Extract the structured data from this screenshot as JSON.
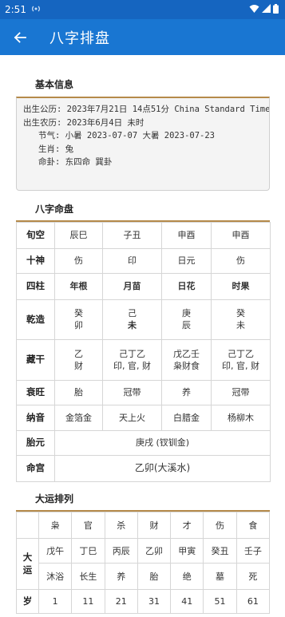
{
  "status": {
    "time": "2:51"
  },
  "appbar": {
    "title": "八字排盘"
  },
  "basic": {
    "title": "基本信息",
    "lines": [
      "出生公历: 2023年7月21日 14点51分 China Standard Time",
      "出生农历: 2023年6月4日 未时",
      "   节气: 小暑 2023-07-07 大暑 2023-07-23",
      "   生肖: 兔",
      "   命卦: 东四命 巽卦"
    ]
  },
  "bazi": {
    "title": "八字命盘",
    "rows": {
      "xunkong": {
        "label": "旬空",
        "cells": [
          "辰巳",
          "子丑",
          "申酉",
          "申酉"
        ]
      },
      "shishen": {
        "label": "十神",
        "cells": [
          "伤",
          "印",
          "日元",
          "伤"
        ]
      },
      "sizhu": {
        "label": "四柱",
        "cells": [
          "年根",
          "月苗",
          "日花",
          "时果"
        ]
      },
      "qianzao": {
        "label": "乾造",
        "cells": [
          [
            "癸",
            "卯"
          ],
          [
            "己",
            "未"
          ],
          [
            "庚",
            "辰"
          ],
          [
            "癸",
            "未"
          ]
        ]
      },
      "canggan": {
        "label": "藏干",
        "cells": [
          [
            "乙",
            "财"
          ],
          [
            "己丁乙",
            "印, 官, 财"
          ],
          [
            "戊乙壬",
            "枭财食"
          ],
          [
            "己丁乙",
            "印, 官, 财"
          ]
        ]
      },
      "shuaiwang": {
        "label": "衰旺",
        "cells": [
          "胎",
          "冠带",
          "养",
          "冠带"
        ]
      },
      "nayin": {
        "label": "纳音",
        "cells": [
          "金箔金",
          "天上火",
          "白腊金",
          "杨柳木"
        ]
      },
      "taiyuan": {
        "label": "胎元",
        "value": "庚戌 (钗钏金)"
      },
      "minggong": {
        "label": "命宫",
        "value": "乙卯(大溪水)"
      }
    }
  },
  "dayun": {
    "title": "大运排列",
    "shishen": [
      "枭",
      "官",
      "杀",
      "财",
      "才",
      "伤",
      "食"
    ],
    "label_dayun": [
      "大",
      "运"
    ],
    "ganzhi": [
      "戊午",
      "丁巳",
      "丙辰",
      "乙卯",
      "甲寅",
      "癸丑",
      "壬子"
    ],
    "changsheng": [
      "沐浴",
      "长生",
      "养",
      "胎",
      "绝",
      "墓",
      "死"
    ],
    "label_sui": "岁",
    "ages": [
      "1",
      "11",
      "21",
      "31",
      "41",
      "51",
      "61"
    ]
  }
}
